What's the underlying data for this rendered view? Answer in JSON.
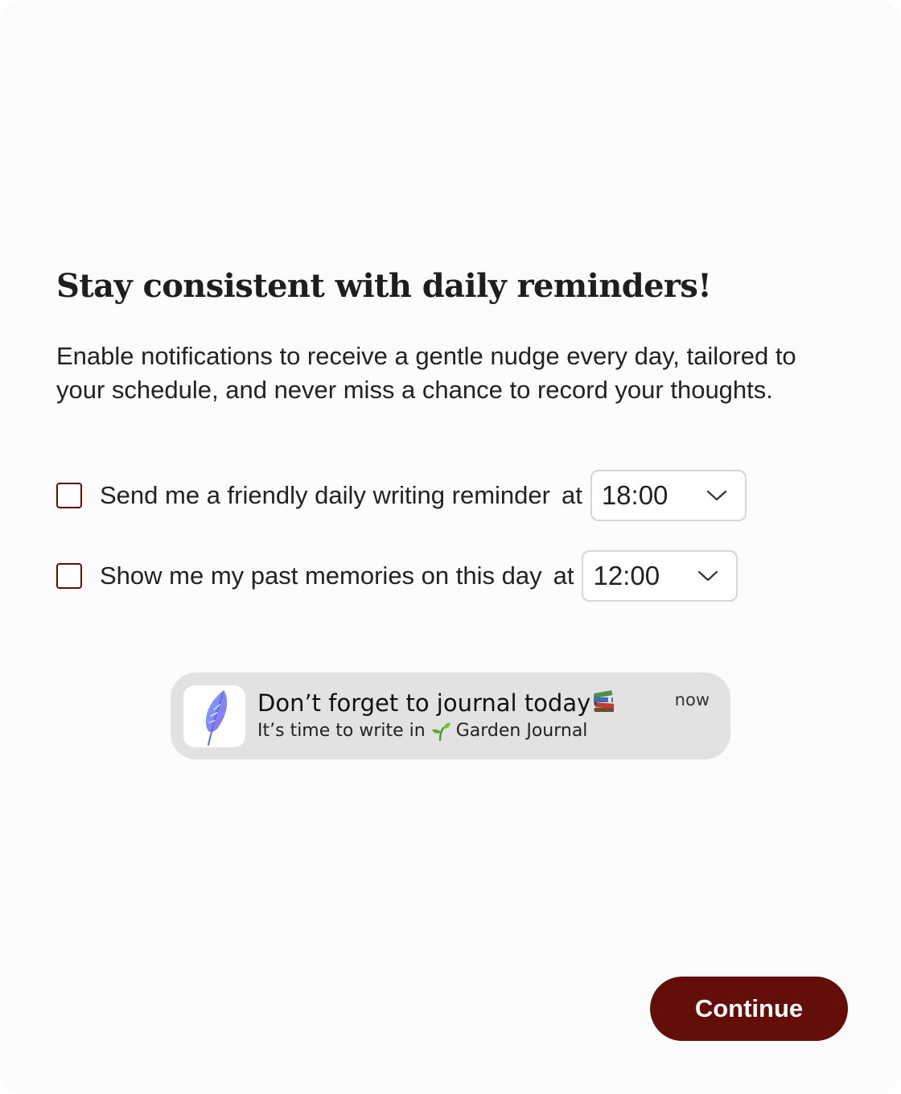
{
  "heading": "Stay consistent with daily reminders!",
  "description": "Enable notifications to receive a gentle nudge every day, tailored to your schedule, and never miss a chance to record your thoughts.",
  "reminders": [
    {
      "label": "Send me a friendly daily writing reminder",
      "at": "at",
      "time": "18:00",
      "checked": false,
      "icon": "chevron-down-icon"
    },
    {
      "label": "Show me my past memories on this day",
      "at": "at",
      "time": "12:00",
      "checked": false,
      "icon": "chevron-down-icon"
    }
  ],
  "notification_preview": {
    "app_icon": "feather-icon",
    "title": "Don’t forget to journal today!",
    "title_emoji": "books-icon",
    "body_prefix": "It’s time to write in",
    "body_emoji": "sprout-icon",
    "body_app": "Garden Journal",
    "time": "now"
  },
  "continue_label": "Continue",
  "colors": {
    "accent": "#630e09",
    "checkbox_border": "#5c0e0c",
    "notification_bg": "#e2e2e2",
    "page_bg": "#fcfcfc"
  }
}
